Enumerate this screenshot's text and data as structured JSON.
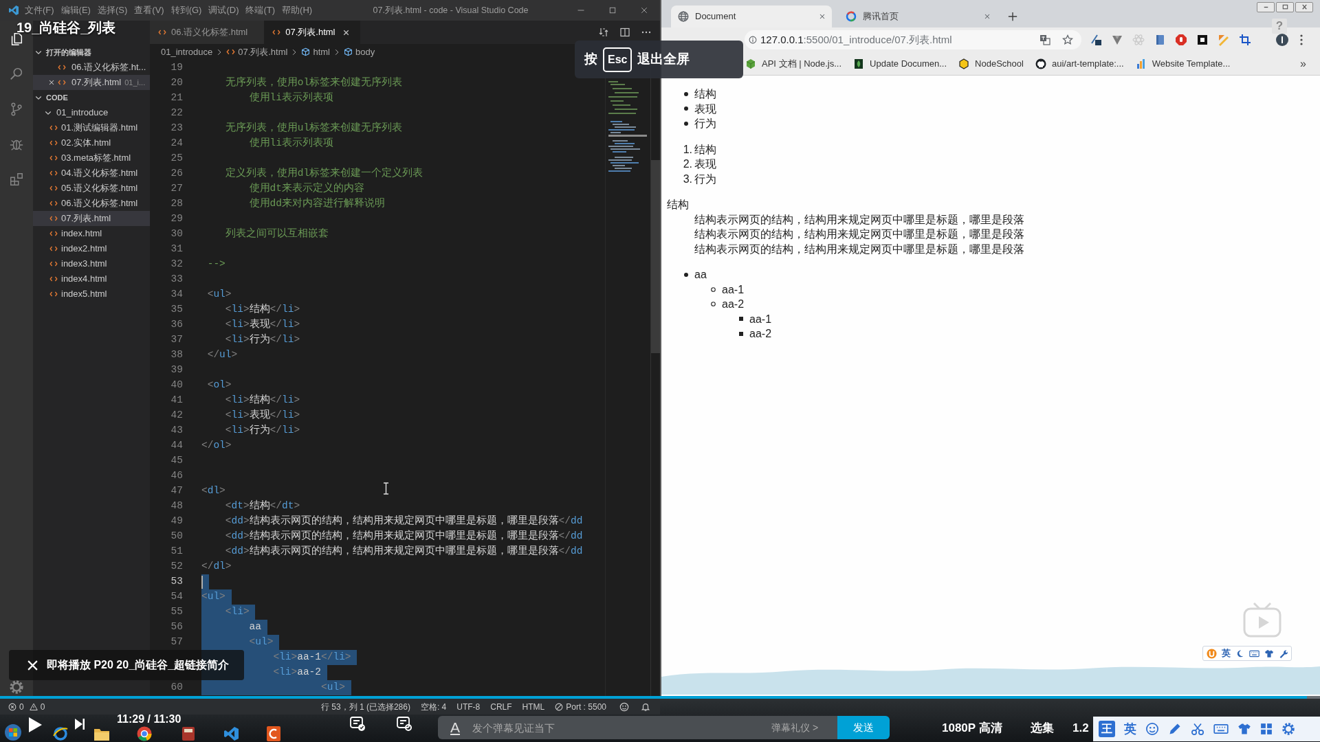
{
  "player": {
    "title": "19_尚硅谷_列表",
    "exit_hint": {
      "before": "按",
      "key": "Esc",
      "after": "退出全屏"
    },
    "next_up": "即将播放 P20 20_尚硅谷_超链接简介",
    "progress": {
      "level": 0.99
    },
    "time": "11:29 / 11:30",
    "danmaku": {
      "style_button": "A",
      "placeholder": "发个弹幕见证当下",
      "etiquette": "弹幕礼仪 >",
      "send": "发送"
    },
    "quality": "1080P 高清",
    "episodes": "选集",
    "speed": "1.2"
  },
  "vscode": {
    "menu": [
      "文件(F)",
      "编辑(E)",
      "选择(S)",
      "查看(V)",
      "转到(G)",
      "调试(D)",
      "终端(T)",
      "帮助(H)"
    ],
    "title": "07.列表.html - code - Visual Studio Code",
    "activity_bar": [
      {
        "kind": "explorer",
        "selected": true
      },
      {
        "kind": "search",
        "selected": false
      },
      {
        "kind": "source-control",
        "selected": false
      },
      {
        "kind": "debug",
        "selected": false
      },
      {
        "kind": "extensions",
        "selected": false
      }
    ],
    "explorer": {
      "open_editors": {
        "header": "打开的编辑器",
        "expanded": true,
        "items": [
          {
            "name": "06.语义化标签.ht...",
            "selected": false
          },
          {
            "name": "07.列表.html",
            "detail": "01_i...",
            "selected": true
          }
        ]
      },
      "folder": {
        "header": "CODE",
        "expanded": true,
        "children": [
          {
            "kind": "folder",
            "name": "01_introduce",
            "expanded": true,
            "selected": false,
            "children": [
              {
                "kind": "file",
                "name": "01.测试编辑器.html",
                "selected": false
              },
              {
                "kind": "file",
                "name": "02.实体.html",
                "selected": false
              },
              {
                "kind": "file",
                "name": "03.meta标签.html",
                "selected": false
              },
              {
                "kind": "file",
                "name": "04.语义化标签.html",
                "selected": false
              },
              {
                "kind": "file",
                "name": "05.语义化标签.html",
                "selected": false
              },
              {
                "kind": "file",
                "name": "06.语义化标签.html",
                "selected": false
              },
              {
                "kind": "file",
                "name": "07.列表.html",
                "selected": true
              },
              {
                "kind": "file",
                "name": "index.html",
                "selected": false
              },
              {
                "kind": "file",
                "name": "index2.html",
                "selected": false
              },
              {
                "kind": "file",
                "name": "index3.html",
                "selected": false
              },
              {
                "kind": "file",
                "name": "index4.html",
                "selected": false
              },
              {
                "kind": "file",
                "name": "index5.html",
                "selected": false
              }
            ]
          }
        ]
      }
    },
    "tabs": [
      {
        "label": "06.语义化标签.html",
        "selected": false
      },
      {
        "label": "07.列表.html",
        "selected": true
      }
    ],
    "breadcrumb": [
      {
        "kind": "folder",
        "label": "01_introduce"
      },
      {
        "kind": "file",
        "label": "07.列表.html"
      },
      {
        "kind": "element",
        "label": "html"
      },
      {
        "kind": "element",
        "label": "body"
      }
    ],
    "code_lines": [
      {
        "number": "19",
        "selected": false,
        "current": false
      },
      {
        "number": "20",
        "kind": "comment",
        "text": "    无序列表，使用ol标签来创建无序列表",
        "selected": false,
        "current": false
      },
      {
        "number": "21",
        "kind": "comment",
        "text": "        使用li表示列表项",
        "selected": false,
        "current": false
      },
      {
        "number": "22",
        "selected": false,
        "current": false
      },
      {
        "number": "23",
        "kind": "comment",
        "text": "    无序列表，使用ul标签来创建无序列表",
        "selected": false,
        "current": false
      },
      {
        "number": "24",
        "kind": "comment",
        "text": "        使用li表示列表项",
        "selected": false,
        "current": false
      },
      {
        "number": "25",
        "selected": false,
        "current": false
      },
      {
        "number": "26",
        "kind": "comment",
        "text": "    定义列表，使用dl标签来创建一个定义列表",
        "selected": false,
        "current": false
      },
      {
        "number": "27",
        "kind": "comment",
        "text": "        使用dt来表示定义的内容",
        "selected": false,
        "current": false
      },
      {
        "number": "28",
        "kind": "comment",
        "text": "        使用dd来对内容进行解释说明",
        "selected": false,
        "current": false
      },
      {
        "number": "29",
        "selected": false,
        "current": false
      },
      {
        "number": "30",
        "kind": "comment",
        "text": "    列表之间可以互相嵌套",
        "selected": false,
        "current": false
      },
      {
        "number": "31",
        "selected": false,
        "current": false
      },
      {
        "number": "32",
        "kind": "comment",
        "text": " -->",
        "selected": false,
        "current": false
      },
      {
        "number": "33",
        "selected": false,
        "current": false
      },
      {
        "number": "34",
        "kind": "markup",
        "text": " <ul>",
        "selected": false,
        "current": false
      },
      {
        "number": "35",
        "kind": "markup",
        "text": "    <li>结构</li>",
        "selected": false,
        "current": false
      },
      {
        "number": "36",
        "kind": "markup",
        "text": "    <li>表现</li>",
        "selected": false,
        "current": false
      },
      {
        "number": "37",
        "kind": "markup",
        "text": "    <li>行为</li>",
        "selected": false,
        "current": false
      },
      {
        "number": "38",
        "kind": "markup",
        "text": " </ul>",
        "selected": false,
        "current": false
      },
      {
        "number": "39",
        "selected": false,
        "current": false
      },
      {
        "number": "40",
        "kind": "markup",
        "text": " <ol>",
        "selected": false,
        "current": false
      },
      {
        "number": "41",
        "kind": "markup",
        "text": "    <li>结构</li>",
        "selected": false,
        "current": false
      },
      {
        "number": "42",
        "kind": "markup",
        "text": "    <li>表现</li>",
        "selected": false,
        "current": false
      },
      {
        "number": "43",
        "kind": "markup",
        "text": "    <li>行为</li>",
        "selected": false,
        "current": false
      },
      {
        "number": "44",
        "kind": "markup",
        "text": "</ol>",
        "selected": false,
        "current": false
      },
      {
        "number": "45",
        "selected": false,
        "current": false
      },
      {
        "number": "46",
        "selected": false,
        "current": false
      },
      {
        "number": "47",
        "kind": "markup",
        "text": "<dl>",
        "selected": false,
        "current": false
      },
      {
        "number": "48",
        "kind": "markup",
        "text": "    <dt>结构</dt>",
        "selected": false,
        "current": false
      },
      {
        "number": "49",
        "kind": "markup",
        "text": "    <dd>结构表示网页的结构，结构用来规定网页中哪里是标题，哪里是段落</dd",
        "selected": false,
        "current": false
      },
      {
        "number": "50",
        "kind": "markup",
        "text": "    <dd>结构表示网页的结构，结构用来规定网页中哪里是标题，哪里是段落</dd",
        "selected": false,
        "current": false
      },
      {
        "number": "51",
        "kind": "markup",
        "text": "    <dd>结构表示网页的结构，结构用来规定网页中哪里是标题，哪里是段落</dd",
        "selected": false,
        "current": false
      },
      {
        "number": "52",
        "kind": "markup",
        "text": "</dl>",
        "selected": false,
        "current": false
      },
      {
        "number": "53",
        "selected": true,
        "current": true
      },
      {
        "number": "54",
        "kind": "markup",
        "text": "<ul>",
        "selected": true,
        "current": false
      },
      {
        "number": "55",
        "kind": "markup",
        "text": "    <li>",
        "selected": true,
        "current": false
      },
      {
        "number": "56",
        "kind": "markup",
        "text": "        aa",
        "selected": true,
        "current": false
      },
      {
        "number": "57",
        "kind": "markup",
        "text": "        <ul>",
        "selected": true,
        "current": false
      },
      {
        "kind": "markup",
        "text": "            <li>aa-1</li>",
        "selected": true,
        "current": false
      },
      {
        "kind": "markup",
        "text": "            <li>aa-2",
        "selected": true,
        "current": false
      },
      {
        "number": "60",
        "kind": "markup",
        "text": "                    <ul>",
        "selected": true,
        "current": false
      }
    ],
    "status_bar": {
      "errors": "0",
      "warnings": "0",
      "items": [
        "行 53，列 1 (已选择286)",
        "空格: 4",
        "UTF-8",
        "CRLF",
        "HTML"
      ],
      "port": "Port : 5500"
    }
  },
  "browser": {
    "tabs": [
      {
        "kind": "globe",
        "title": "Document",
        "selected": true
      },
      {
        "kind": "ring",
        "title": "腾讯首页",
        "selected": false
      }
    ],
    "url": {
      "host": "127.0.0.1",
      "rest": ":5500/01_introduce/07.列表.html"
    },
    "bookmarks": [
      {
        "kind": "cube",
        "label": "API 文档 | Node.js..."
      },
      {
        "kind": "leaf",
        "label": "Update Documen..."
      },
      {
        "kind": "hexagon",
        "label": "NodeSchool"
      },
      {
        "kind": "cat",
        "label": "aui/art-template:..."
      },
      {
        "kind": "chart",
        "label": "Website Template..."
      }
    ],
    "bookmarks_more": "»",
    "help": "?",
    "page": {
      "unordered": [
        "结构",
        "表现",
        "行为"
      ],
      "ordered": [
        {
          "marker": "1.",
          "text": "结构"
        },
        {
          "marker": "2.",
          "text": "表现"
        },
        {
          "marker": "3.",
          "text": "行为"
        }
      ],
      "definition": {
        "term": "结构",
        "descriptions": [
          "结构表示网页的结构，结构用来规定网页中哪里是标题，哪里是段落",
          "结构表示网页的结构，结构用来规定网页中哪里是标题，哪里是段落",
          "结构表示网页的结构，结构用来规定网页中哪里是标题，哪里是段落"
        ]
      },
      "nested": [
        {
          "text": "aa",
          "children": [
            {
              "text": "aa-1"
            },
            {
              "text": "aa-2",
              "children": [
                {
                  "text": "aa-1"
                },
                {
                  "text": "aa-2"
                }
              ]
            }
          ]
        }
      ]
    }
  },
  "ime": {
    "floating_mode": "英",
    "toolbar_badge": "王",
    "toolbar_mode": "英"
  }
}
